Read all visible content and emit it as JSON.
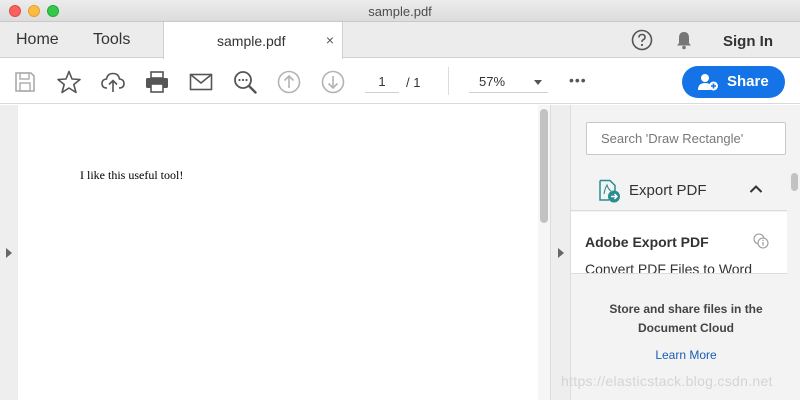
{
  "window": {
    "title": "sample.pdf"
  },
  "tabbar": {
    "home": "Home",
    "tools": "Tools",
    "doc_tab": "sample.pdf",
    "close_glyph": "×",
    "sign_in": "Sign In"
  },
  "toolbar": {
    "icons": [
      "save-icon",
      "star-icon",
      "upload-cloud-icon",
      "print-icon",
      "email-icon",
      "zoom-search-icon",
      "page-up-icon",
      "page-down-icon"
    ],
    "page_current": "1",
    "page_total": "/ 1",
    "zoom": "57%",
    "more": "•••",
    "share": "Share"
  },
  "document": {
    "text": "I like this useful tool!"
  },
  "right_pane": {
    "search_placeholder": "Search 'Draw Rectangle'",
    "export_label": "Export PDF",
    "card_title": "Adobe Export PDF",
    "card_desc": "Convert PDF Files to Word",
    "cloud_text": "Store and share files in the Document Cloud",
    "learn_more": "Learn More"
  },
  "watermark": "https://elasticstack.blog.csdn.net",
  "colors": {
    "accent": "#1473e6",
    "link": "#1a5db5",
    "export_icon": "#2a8c8c"
  }
}
